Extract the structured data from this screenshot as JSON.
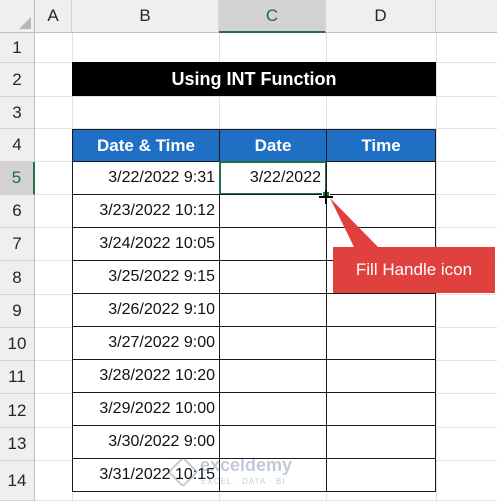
{
  "columns": [
    "A",
    "B",
    "C",
    "D"
  ],
  "rows": [
    "1",
    "2",
    "3",
    "4",
    "5",
    "6",
    "7",
    "8",
    "9",
    "10",
    "11",
    "12",
    "13",
    "14"
  ],
  "selected_column": "C",
  "selected_row": "5",
  "title": "Using INT Function",
  "table": {
    "headers": [
      "Date & Time",
      "Date",
      "Time"
    ],
    "rows": [
      {
        "datetime": "3/22/2022 9:31",
        "date": "3/22/2022",
        "time": ""
      },
      {
        "datetime": "3/23/2022 10:12",
        "date": "",
        "time": ""
      },
      {
        "datetime": "3/24/2022 10:05",
        "date": "",
        "time": ""
      },
      {
        "datetime": "3/25/2022 9:15",
        "date": "",
        "time": ""
      },
      {
        "datetime": "3/26/2022 9:10",
        "date": "",
        "time": ""
      },
      {
        "datetime": "3/27/2022 9:00",
        "date": "",
        "time": ""
      },
      {
        "datetime": "3/28/2022 10:20",
        "date": "",
        "time": ""
      },
      {
        "datetime": "3/29/2022 10:00",
        "date": "",
        "time": ""
      },
      {
        "datetime": "3/30/2022 9:00",
        "date": "",
        "time": ""
      },
      {
        "datetime": "3/31/2022 10:15",
        "date": "",
        "time": ""
      }
    ]
  },
  "callout": {
    "label": "Fill Handle icon",
    "color": "#e0413e"
  },
  "watermark": {
    "name": "exceldemy",
    "tagline": "EXCEL · DATA · BI"
  },
  "colors": {
    "header_blue": "#1f6fc5",
    "excel_green": "#217346"
  }
}
